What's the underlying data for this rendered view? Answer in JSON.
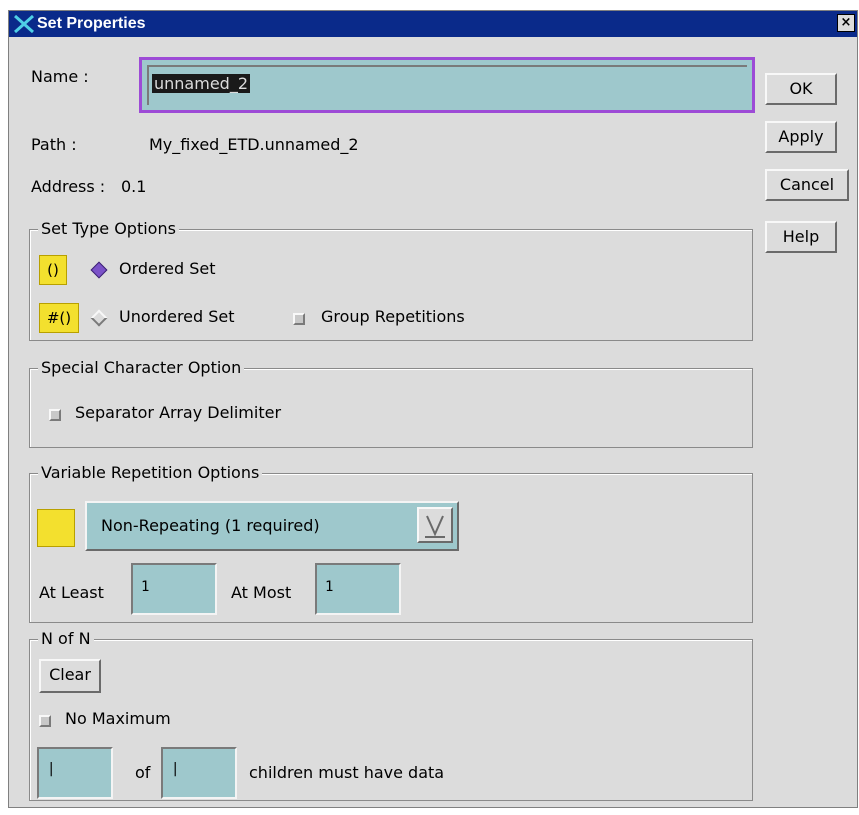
{
  "window": {
    "title": "Set Properties",
    "close_label": "×"
  },
  "form": {
    "name_label": "Name :",
    "name_value": "unnamed_2",
    "path_label": "Path :",
    "path_value": "My_fixed_ETD.unnamed_2",
    "address_label": "Address :",
    "address_value": "0.1"
  },
  "buttons": {
    "ok": "OK",
    "apply": "Apply",
    "cancel": "Cancel",
    "help": "Help"
  },
  "set_type": {
    "title": "Set Type Options",
    "ordered_badge": "()",
    "ordered_label": "Ordered Set",
    "ordered_selected": true,
    "unordered_badge": "#()",
    "unordered_label": "Unordered Set",
    "group_repetitions_label": "Group Repetitions"
  },
  "special_char": {
    "title": "Special Character Option",
    "separator_label": "Separator Array Delimiter"
  },
  "variable_rep": {
    "title": "Variable Repetition Options",
    "selected_option": "Non-Repeating (1 required)",
    "at_least_label": "At Least",
    "at_least_value": "1",
    "at_most_label": "At Most",
    "at_most_value": "1"
  },
  "n_of_n": {
    "title": "N of N",
    "clear_label": "Clear",
    "no_maximum_label": "No Maximum",
    "of_label": "of",
    "children_label": "children must have data"
  },
  "colors": {
    "title_bar": "#0a2a8a",
    "dialog_bg": "#dcdcdc",
    "field_bg": "#9ec8cc",
    "focus_border": "#9d4bd6",
    "badge_yellow": "#f3e02e",
    "radio_selected": "#7b52c8"
  }
}
